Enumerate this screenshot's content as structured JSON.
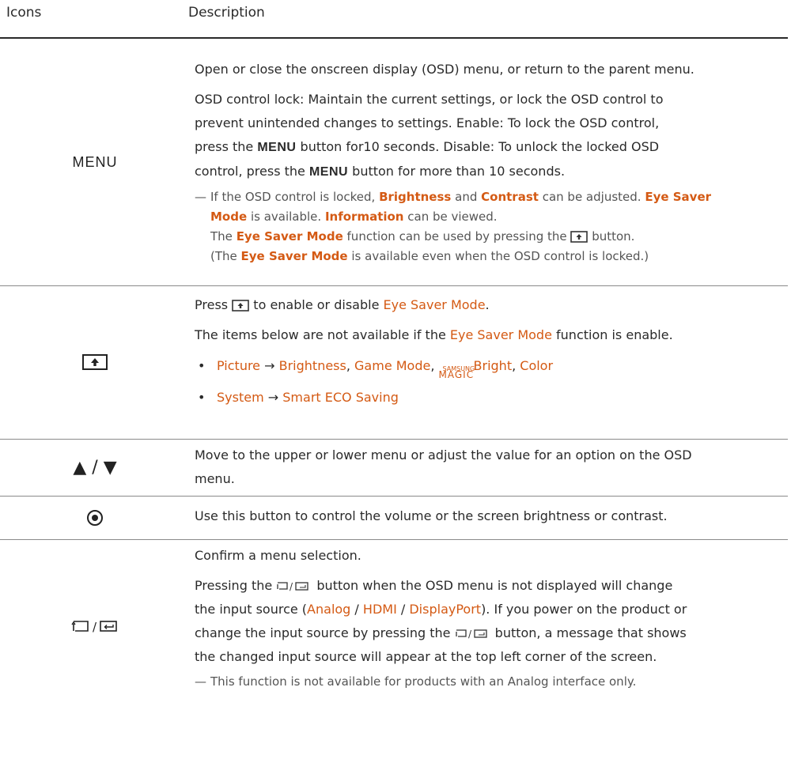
{
  "header": {
    "icons": "Icons",
    "description": "Description"
  },
  "rows": [
    {
      "icon": "MENU",
      "p1": "Open or close the onscreen display (OSD) menu, or return to the parent menu.",
      "p2_l1": "OSD control lock: Maintain the current settings, or lock the OSD control to",
      "p2_l2": "prevent unintended changes to settings. Enable: To lock the OSD control,",
      "p2_l3a": "press the",
      "menu_word": "MENU",
      "p2_l3b": "button for10 seconds. Disable: To unlock the locked OSD",
      "p2_l4a": "control, press the",
      "p2_l4b": "button for more than 10 seconds.",
      "note1_a": "If the OSD control is locked,",
      "brightness": "Brightness",
      "and": "and",
      "contrast": "Contrast",
      "note1_b": "can be adjusted.",
      "eye_saver": "Eye Saver",
      "mode": "Mode",
      "note1_c": "is available.",
      "information": "Information",
      "note1_d": "can be viewed.",
      "note2_a": "The",
      "eye_saver_mode": "Eye Saver Mode",
      "note2_b": "function can be used by pressing the",
      "note2_c": "button.",
      "note3_a": "(The",
      "note3_b": "is available even when the OSD control is locked.)"
    },
    {
      "icon": "eye-saver-button",
      "p1_a": "Press",
      "p1_b": "to enable or disable",
      "eye_saver_mode": "Eye Saver Mode",
      "p2_a": "The items below are not available if the",
      "p2_b": "function is enable.",
      "b1_picture": "Picture",
      "arrow": "→",
      "b1_brightness": "Brightness",
      "b1_game": "Game Mode",
      "samsung": "SAMSUNG",
      "magic": "MAGIC",
      "b1_bright": "Bright",
      "b1_color": "Color",
      "b2_system": "System",
      "b2_eco": "Smart ECO Saving"
    },
    {
      "icon": "▲ / ▼",
      "p1_l1": "Move to the upper or lower menu or adjust the value for an option on the OSD",
      "p1_l2": "menu."
    },
    {
      "icon": "joystick-center-button",
      "p1": "Use this button to control the volume or the screen brightness or contrast."
    },
    {
      "icon": "source-enter-button",
      "p1": "Confirm a menu selection.",
      "p2_l1a": "Pressing the",
      "p2_l1b": "button when the OSD menu is not displayed will change",
      "p2_l2a": "the input source (",
      "analog": "Analog",
      "slash": "/",
      "hdmi": "HDMI",
      "displayport": "DisplayPort",
      "p2_l2b": "). If you power on the product or",
      "p2_l3a": "change the input source by pressing the",
      "p2_l3b": "button, a message that shows",
      "p2_l4": "the changed input source will appear at the top left corner of the screen.",
      "note": "This function is not available for products with an Analog interface only."
    }
  ],
  "colors": {
    "accent": "#d45a14",
    "text": "#2a2a2a",
    "note": "#555555"
  }
}
